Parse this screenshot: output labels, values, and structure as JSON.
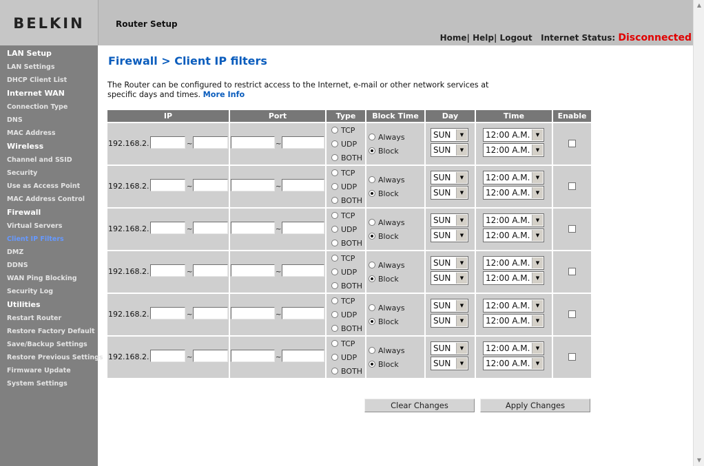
{
  "header": {
    "logo": "BELKIN",
    "title": "Router Setup",
    "links": [
      "Home",
      "Help",
      "Logout"
    ],
    "status_label": "Internet Status:",
    "status_value": "Disconnected",
    "status_color": "#e00000"
  },
  "sidebar": {
    "sections": [
      {
        "title": "LAN Setup",
        "items": [
          "LAN Settings",
          "DHCP Client List"
        ]
      },
      {
        "title": "Internet WAN",
        "items": [
          "Connection Type",
          "DNS",
          "MAC Address"
        ]
      },
      {
        "title": "Wireless",
        "items": [
          "Channel and SSID",
          "Security",
          "Use as Access Point",
          "MAC Address Control"
        ]
      },
      {
        "title": "Firewall",
        "items": [
          "Virtual Servers",
          "Client IP Filters",
          "DMZ",
          "DDNS",
          "WAN Ping Blocking",
          "Security Log"
        ]
      },
      {
        "title": "Utilities",
        "items": [
          "Restart Router",
          "Restore Factory Default",
          "Save/Backup Settings",
          "Restore Previous Settings",
          "Firmware Update",
          "System Settings"
        ]
      }
    ],
    "active_item": "Client IP Filters",
    "active_color": "#6699ff"
  },
  "main": {
    "title": "Firewall > Client IP filters",
    "description": "The Router can be configured to restrict access to the Internet, e-mail or other network services at specific days and times.",
    "more_info": "More Info",
    "accent_color": "#0b5dbd"
  },
  "table": {
    "headers": {
      "ip": "IP",
      "port": "Port",
      "type": "Type",
      "block_time": "Block Time",
      "day": "Day",
      "time": "Time",
      "enable": "Enable"
    },
    "ip_prefix": "192.168.2.",
    "range_separator": "~",
    "type_options": [
      "TCP",
      "UDP",
      "BOTH"
    ],
    "block_options": [
      "Always",
      "Block"
    ],
    "rows": [
      {
        "block_selected": "Block",
        "day_from": "SUN",
        "day_to": "SUN",
        "time_from": "12:00 A.M.",
        "time_to": "12:00 A.M.",
        "enabled": false
      },
      {
        "block_selected": "Block",
        "day_from": "SUN",
        "day_to": "SUN",
        "time_from": "12:00 A.M.",
        "time_to": "12:00 A.M.",
        "enabled": false
      },
      {
        "block_selected": "Block",
        "day_from": "SUN",
        "day_to": "SUN",
        "time_from": "12:00 A.M.",
        "time_to": "12:00 A.M.",
        "enabled": false
      },
      {
        "block_selected": "Block",
        "day_from": "SUN",
        "day_to": "SUN",
        "time_from": "12:00 A.M.",
        "time_to": "12:00 A.M.",
        "enabled": false
      },
      {
        "block_selected": "Block",
        "day_from": "SUN",
        "day_to": "SUN",
        "time_from": "12:00 A.M.",
        "time_to": "12:00 A.M.",
        "enabled": false
      },
      {
        "block_selected": "Block",
        "day_from": "SUN",
        "day_to": "SUN",
        "time_from": "12:00 A.M.",
        "time_to": "12:00 A.M.",
        "enabled": false
      }
    ]
  },
  "buttons": {
    "clear": "Clear Changes",
    "apply": "Apply Changes"
  }
}
